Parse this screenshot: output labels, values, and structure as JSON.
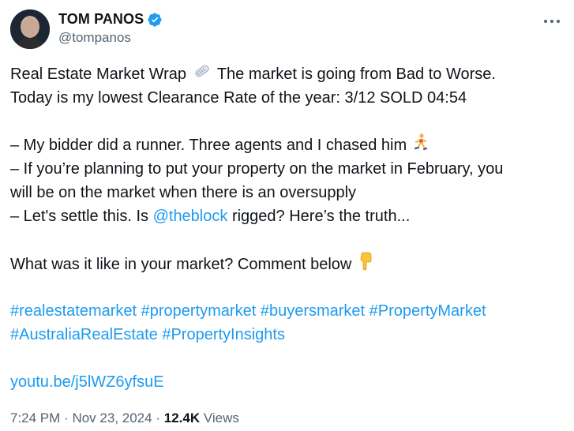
{
  "author": {
    "name": "TOM PANOS",
    "handle": "@tompanos"
  },
  "tweet": {
    "line1a": "Real Estate Market Wrap",
    "line1b": "The market is going from Bad to Worse.",
    "line2": "Today is my lowest Clearance Rate of the year: 3/12 SOLD 04:54",
    "line3": "– My bidder did a runner. Three agents and I chased him",
    "line4": "– If you’re planning to put your property on the market in February, you",
    "line5": "will be on the market when there is an oversupply",
    "line6a": "– Let's settle this. Is",
    "mention": "@theblock",
    "line6b": "rigged? Here’s the truth...",
    "line7": "What was it like in your market? Comment below",
    "hashtags": [
      "#realestatemarket",
      "#propertymarket",
      "#buyersmarket",
      "#PropertyMarket",
      "#AustraliaRealEstate",
      "#PropertyInsights"
    ],
    "link": "youtu.be/j5lWZ6yfsuE"
  },
  "meta": {
    "time": "7:24 PM",
    "date": "Nov 23, 2024",
    "views_count": "12.4K",
    "views_label": "Views",
    "separator": "·"
  },
  "icons": {
    "verified": "verified-badge-icon",
    "more": "more-options-icon",
    "newspaper": "newspaper-emoji",
    "runner": "person-running-emoji",
    "point_down": "backhand-index-pointing-down-emoji"
  },
  "colors": {
    "link": "#1d9bf0",
    "secondary_text": "#536471",
    "primary_text": "#0f1419"
  }
}
